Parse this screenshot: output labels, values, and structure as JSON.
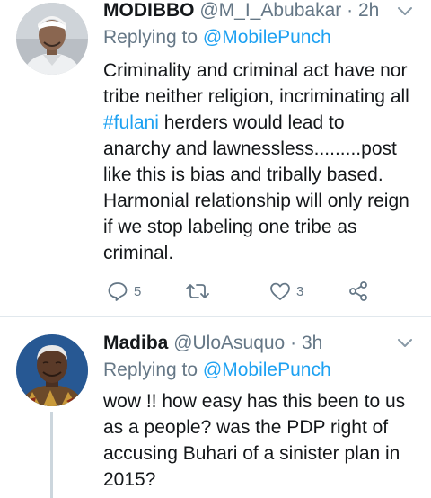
{
  "tweets": [
    {
      "name": "MODIBBO",
      "handle": "@M_I_Abubakar",
      "separator": "·",
      "time": "2h",
      "replying_prefix": "Replying to ",
      "replying_to": "@MobilePunch",
      "text_before_hashtag": "Criminality and criminal act have nor tribe  neither religion, incriminating all ",
      "hashtag": "#fulani",
      "text_after_hashtag": " herders would lead to anarchy and lawnessless.........post like this is bias and tribally based. Harmonial relationship will only reign if we stop labeling one tribe as criminal.",
      "reply_count": "5",
      "retweet_count": "",
      "like_count": "3",
      "avatar_icon": "profile-photo-man-white-cap",
      "icons": [
        "reply-icon",
        "retweet-icon",
        "like-icon",
        "share-icon",
        "chevron-down-icon"
      ]
    },
    {
      "name": "Madiba",
      "handle": "@UloAsuquo",
      "separator": "·",
      "time": "3h",
      "replying_prefix": "Replying to ",
      "replying_to": "@MobilePunch",
      "text": "wow !! how easy has this been to us as a people? was the PDP right of accusing Buhari of a sinister plan in 2015?",
      "avatar_icon": "profile-photo-elderly-man-patterned-shirt"
    }
  ],
  "colors": {
    "link": "#1da1f2",
    "secondary": "#657786",
    "text": "#14171a",
    "divider": "#e1e8ed",
    "thread_line": "#ccd6dd"
  }
}
